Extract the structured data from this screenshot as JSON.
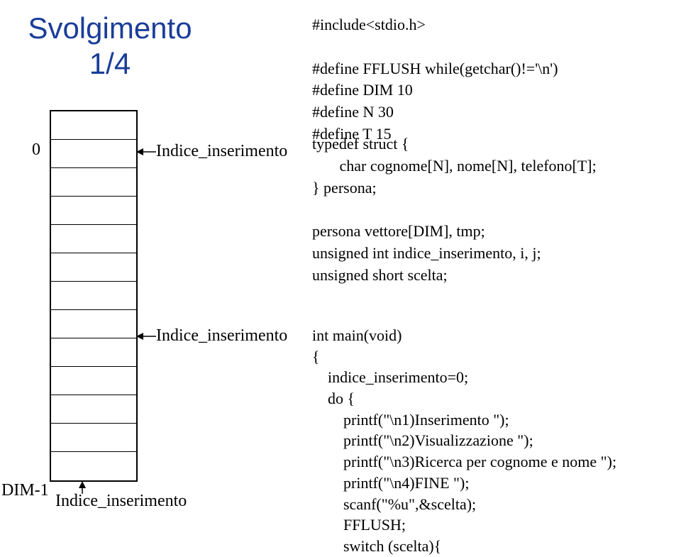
{
  "title_line1": "Svolgimento",
  "title_line2": "1/4",
  "index_label_0": "0",
  "index_label_dim": "DIM-1",
  "arrow_label_1": "Indice_inserimento",
  "arrow_label_2": "Indice_inserimento",
  "arrow_label_3": "Indice_inserimento",
  "code_block1": "#include<stdio.h>\n\n#define FFLUSH while(getchar()!='\\n')\n#define DIM 10\n#define N 30\n#define T 15",
  "code_block2": "typedef struct {\n       char cognome[N], nome[N], telefono[T];\n} persona;\n\npersona vettore[DIM], tmp;\nunsigned int indice_inserimento, i, j;\nunsigned short scelta;",
  "code_block3": "int main(void)\n{\n    indice_inserimento=0;\n    do {\n        printf(\"\\n1)Inserimento \");\n        printf(\"\\n2)Visualizzazione \");\n        printf(\"\\n3)Ricerca per cognome e nome \");\n        printf(\"\\n4)FINE \");\n        scanf(\"%u\",&scelta);\n        FFLUSH;\n        switch (scelta){"
}
